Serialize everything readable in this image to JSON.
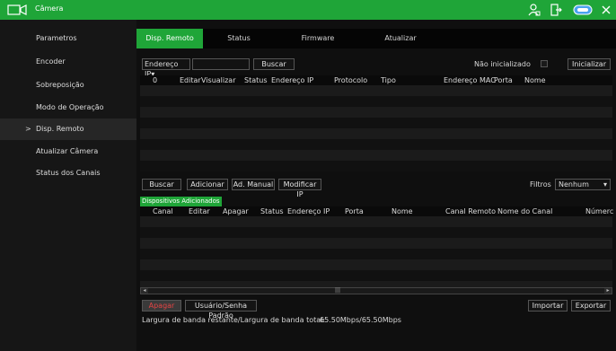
{
  "window": {
    "title": "Câmera",
    "icons": [
      "camera-icon",
      "user-icon",
      "logout-icon",
      "toggle-icon",
      "close-icon"
    ]
  },
  "sidebar": {
    "items": [
      {
        "label": "Parametros",
        "active": false
      },
      {
        "label": "Encoder",
        "active": false
      },
      {
        "label": "Sobreposição",
        "active": false
      },
      {
        "label": "Modo de Operação",
        "active": false
      },
      {
        "label": "Disp. Remoto",
        "active": true
      },
      {
        "label": "Atualizar Câmera",
        "active": false
      },
      {
        "label": "Status dos Canais",
        "active": false
      }
    ],
    "active_marker": ">"
  },
  "tabs": [
    {
      "label": "Disp. Remoto",
      "active": true
    },
    {
      "label": "Status",
      "active": false
    },
    {
      "label": "Firmware",
      "active": false
    },
    {
      "label": "Atualizar",
      "active": false
    }
  ],
  "search_bar": {
    "filter_select": "Endereço IP",
    "filter_arrow": "▾",
    "input_value": "",
    "search_label": "Buscar",
    "uninit_label": "Não inicializado",
    "initialize_label": "Inicializar"
  },
  "device_table": {
    "headers": [
      "0",
      "Editar",
      "Visualizar",
      "Status",
      "Endereço IP",
      "Protocolo",
      "Tipo",
      "Endereço MAC",
      "Porta",
      "Nome"
    ],
    "rows": 8,
    "scroll_left": "◂",
    "scroll_mid": "|||",
    "scroll_right": "▸"
  },
  "actions": {
    "search": "Buscar",
    "add": "Adicionar",
    "manual_add": "Ad. Manual",
    "modify_ip": "Modificar IP",
    "filter_label": "Filtros",
    "filter_value": "Nenhum",
    "filter_arrow": "▾"
  },
  "added_section": {
    "title": "Dispositivos Adicionados",
    "headers": [
      "Canal",
      "Editar",
      "Apagar",
      "Status",
      "Endereço IP",
      "Porta",
      "Nome",
      "Canal Remoto",
      "Nome do Canal",
      "Númerc"
    ],
    "rows": 8,
    "scroll_left": "◂",
    "scroll_mid": "|||",
    "scroll_right": "▸"
  },
  "footer": {
    "delete_label": "Apagar",
    "user_pass_label": "Usuário/Senha Padrão",
    "import_label": "Importar",
    "export_label": "Exportar",
    "bandwidth_label": "Largura de banda restante/Largura de banda total:",
    "bandwidth_value": "65.50Mbps/65.50Mbps"
  },
  "colors": {
    "accent": "#1fa538",
    "delete_text": "#e34444"
  }
}
